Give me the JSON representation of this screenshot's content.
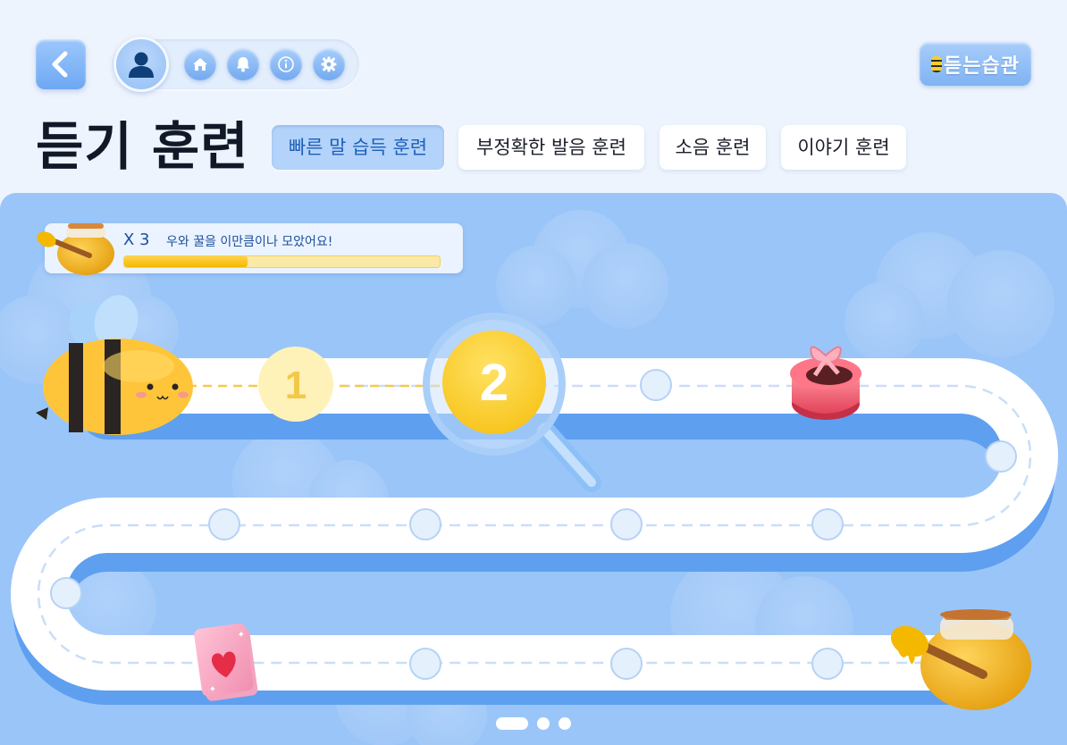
{
  "header": {
    "back_icon": "chevron-left-icon",
    "nav_icons": [
      "user-icon",
      "home-icon",
      "bell-icon",
      "info-icon",
      "gear-icon"
    ],
    "brand": "듣는습관"
  },
  "page": {
    "title": "듣기 훈련",
    "tabs": [
      {
        "label": "빠른 말 습득 훈련",
        "active": true
      },
      {
        "label": "부정확한 발음 훈련",
        "active": false
      },
      {
        "label": "소음 훈련",
        "active": false
      },
      {
        "label": "이야기 훈련",
        "active": false
      }
    ]
  },
  "progress": {
    "multiplier": "X 3",
    "message": "우와 꿀을 이만큼이나 모았어요!",
    "fraction": 0.39,
    "icon": "honey-jar-icon"
  },
  "map": {
    "levels": [
      {
        "label": "1",
        "state": "completed"
      },
      {
        "label": "2",
        "state": "current"
      }
    ],
    "rewards": [
      "gift-box-icon",
      "heart-card-icon",
      "honey-pot-icon"
    ],
    "character": "bee-icon"
  },
  "pagination": {
    "pages": 3,
    "current": 1
  },
  "colors": {
    "accent": "#6ea8f3",
    "board": "#9ac5f8",
    "honey": "#f5b800",
    "level_current": "#ffd232",
    "level_completed": "#fff2b8"
  }
}
